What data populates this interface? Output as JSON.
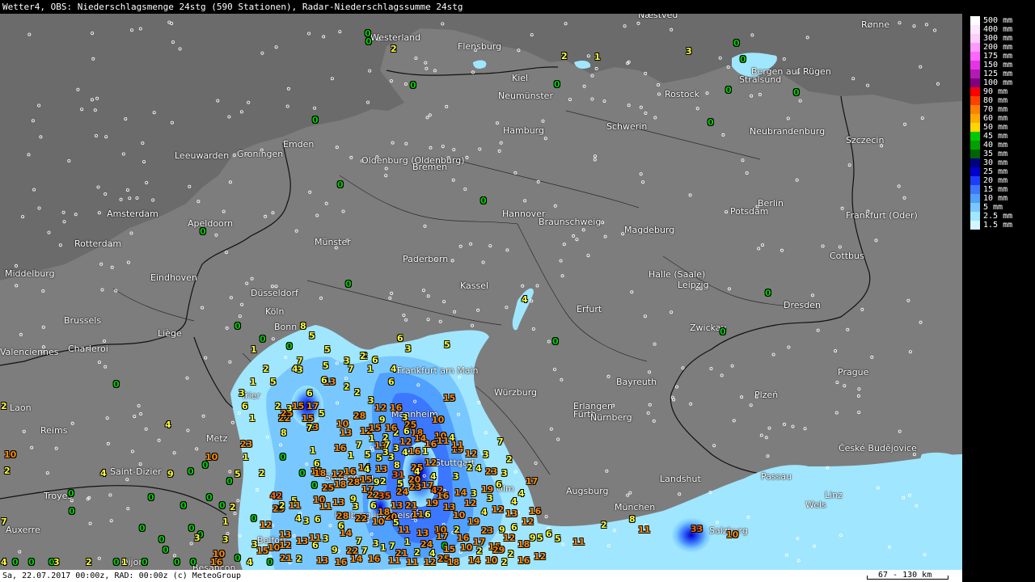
{
  "title": "Wetter4, OBS: Niederschlagsmenge 24stg (590 Stationen), Radar-Niederschlagssumme 24stg",
  "status": "Sa, 22.07.2017 00:00z, RAD: 00:00z (c) MeteoGroup",
  "scale": "67 - 130 km",
  "colors": {
    "sea": "#6b6b6b",
    "land": "#7d7d7d",
    "border": "#111111",
    "marker": "#ffffff"
  },
  "legend": [
    {
      "label": "500 mm",
      "color": "#ffffff"
    },
    {
      "label": "400 mm",
      "color": "#ffe6ff"
    },
    {
      "label": "300 mm",
      "color": "#ffccff"
    },
    {
      "label": "200 mm",
      "color": "#ff99ff"
    },
    {
      "label": "175 mm",
      "color": "#ff66ff"
    },
    {
      "label": "150 mm",
      "color": "#e633e6"
    },
    {
      "label": "125 mm",
      "color": "#b31ab3"
    },
    {
      "label": "100 mm",
      "color": "#800080"
    },
    {
      "label": "90 mm",
      "color": "#ff0000"
    },
    {
      "label": "80 mm",
      "color": "#ff4000"
    },
    {
      "label": "70 mm",
      "color": "#ff8000"
    },
    {
      "label": "60 mm",
      "color": "#ffaa00"
    },
    {
      "label": "50 mm",
      "color": "#ffd700"
    },
    {
      "label": "45 mm",
      "color": "#00c800"
    },
    {
      "label": "40 mm",
      "color": "#00a000"
    },
    {
      "label": "35 mm",
      "color": "#006400"
    },
    {
      "label": "30 mm",
      "color": "#000080"
    },
    {
      "label": "25 mm",
      "color": "#0000cd"
    },
    {
      "label": "20 mm",
      "color": "#1e3cff"
    },
    {
      "label": "15 mm",
      "color": "#3c78ff"
    },
    {
      "label": "10 mm",
      "color": "#50a0ff"
    },
    {
      "label": "5 mm",
      "color": "#78c8ff"
    },
    {
      "label": "2.5 mm",
      "color": "#a0e6ff"
    },
    {
      "label": "1.5 mm",
      "color": "#d2f5ff"
    }
  ],
  "cities": [
    "Næstved",
    "Rønne",
    "Westerland",
    "Flensburg",
    "Kiel",
    "Rostock",
    "Bergen auf Rügen",
    "Stralsund",
    "Neumünster",
    "Hamburg",
    "Schwerin",
    "Neubrandenburg",
    "Szczecin",
    "Emden",
    "Groningen",
    "Leeuwarden",
    "Oldenburg (Oldenburg)",
    "Bremen",
    "Amsterdam",
    "Apeldoorn",
    "Hannover",
    "Braunschweig",
    "Magdeburg",
    "Berlin",
    "Potsdam",
    "Frankfurt (Oder)",
    "Rotterdam",
    "Münster",
    "Paderborn",
    "Middelburg",
    "Eindhoven",
    "Düsseldorf",
    "Kassel",
    "Halle (Saale)",
    "Leipzig",
    "Cottbus",
    "Köln",
    "Bonn",
    "Erfurt",
    "Dresden",
    "Brussels",
    "Liège",
    "Zwickau",
    "Valenciennes",
    "Charleroi",
    "Prague",
    "Frankfurt am Main",
    "Bayreuth",
    "Trier",
    "Würzburg",
    "Plzeň",
    "Laon",
    "Mannheim",
    "Erlangen",
    "Fürth",
    "Nürnberg",
    "Reims",
    "Metz",
    "Stuttgart",
    "České Budějovice",
    "Saint-Dizier",
    "Strasbourg",
    "Ulm",
    "Augsburg",
    "Landshut",
    "Passau",
    "Troyes",
    "Freiburg im Breisgau",
    "München",
    "Linz",
    "Wels",
    "Auxerre",
    "Belfort",
    "Salzburg",
    "Dijon",
    "Besançon"
  ],
  "observations": [
    "0",
    "0",
    "0",
    "2",
    "2",
    "1",
    "3",
    "0",
    "0",
    "0",
    "0",
    "0",
    "0",
    "0",
    "0",
    "0",
    "0",
    "0",
    "0",
    "0",
    "0",
    "0",
    "0",
    "4",
    "0",
    "8",
    "5",
    "1",
    "0",
    "7",
    "5",
    "3",
    "2",
    "6",
    "6",
    "3",
    "5",
    "2",
    "4",
    "5",
    "7",
    "2",
    "1",
    "4",
    "5",
    "1",
    "13",
    "2",
    "6",
    "15",
    "6",
    "3",
    "17",
    "2",
    "5",
    "6",
    "1",
    "22",
    "15",
    "25",
    "15",
    "13",
    "2",
    "3",
    "12",
    "16",
    "9",
    "2",
    "3",
    "10",
    "16",
    "25",
    "18",
    "8",
    "7",
    "10",
    "28",
    "12",
    "15",
    "2",
    "6",
    "14",
    "10",
    "4",
    "13",
    "3",
    "3",
    "16",
    "1",
    "5",
    "5",
    "3",
    "4",
    "1",
    "19",
    "14",
    "13",
    "8",
    "25",
    "12",
    "2",
    "3",
    "7",
    "2",
    "5",
    "10",
    "23",
    "1",
    "16",
    "4",
    "2",
    "5",
    "4",
    "4",
    "6",
    "25",
    "18",
    "17",
    "35",
    "24",
    "23",
    "42",
    "3",
    "19",
    "6",
    "11",
    "42",
    "5",
    "10",
    "13",
    "9",
    "6",
    "13",
    "21",
    "19",
    "13",
    "12",
    "12",
    "4",
    "16",
    "11",
    "29",
    "12",
    "13",
    "4",
    "6",
    "28",
    "22",
    "10",
    "20",
    "11",
    "13",
    "10",
    "2",
    "23",
    "9",
    "6",
    "11",
    "3",
    "14",
    "7",
    "3",
    "7",
    "1",
    "24",
    "0",
    "16",
    "17",
    "15",
    "12",
    "18",
    "5",
    "3",
    "10",
    "12",
    "13",
    "6",
    "9",
    "22",
    "7",
    "1",
    "21",
    "2",
    "4",
    "15",
    "10",
    "2",
    "29",
    "2",
    "10",
    "0",
    "4",
    "15",
    "21",
    "2",
    "13",
    "16",
    "14",
    "16",
    "11",
    "11",
    "12",
    "25",
    "18",
    "14",
    "10",
    "2",
    "16",
    "12",
    "5",
    "3",
    "3",
    "6",
    "13",
    "7",
    "1",
    "7",
    "12",
    "16",
    "16",
    "11",
    "11",
    "12",
    "4",
    "23",
    "3",
    "4",
    "17",
    "3",
    "11",
    "6",
    "3",
    "22",
    "18",
    "5",
    "11",
    "6",
    "17",
    "10",
    "19",
    "4",
    "18",
    "12",
    "28",
    "15",
    "9",
    "31",
    "20",
    "17",
    "16",
    "14",
    "3",
    "3",
    "13",
    "12",
    "9",
    "6",
    "11",
    "2",
    "8",
    "11",
    "33",
    "10",
    "2",
    "10",
    "0",
    "4",
    "9",
    "0",
    "0",
    "0",
    "3",
    "0",
    "0",
    "0",
    "0",
    "0",
    "4",
    "0",
    "0",
    "0",
    "0",
    "0",
    "1",
    "2",
    "0",
    "0",
    "0",
    "2",
    "0",
    "0",
    "2",
    "0",
    "0",
    "0",
    "1",
    "7",
    "2",
    "0",
    "3",
    "2",
    "1",
    "0",
    "0",
    "3",
    "16",
    "4",
    "0",
    "0",
    "0",
    "1"
  ]
}
